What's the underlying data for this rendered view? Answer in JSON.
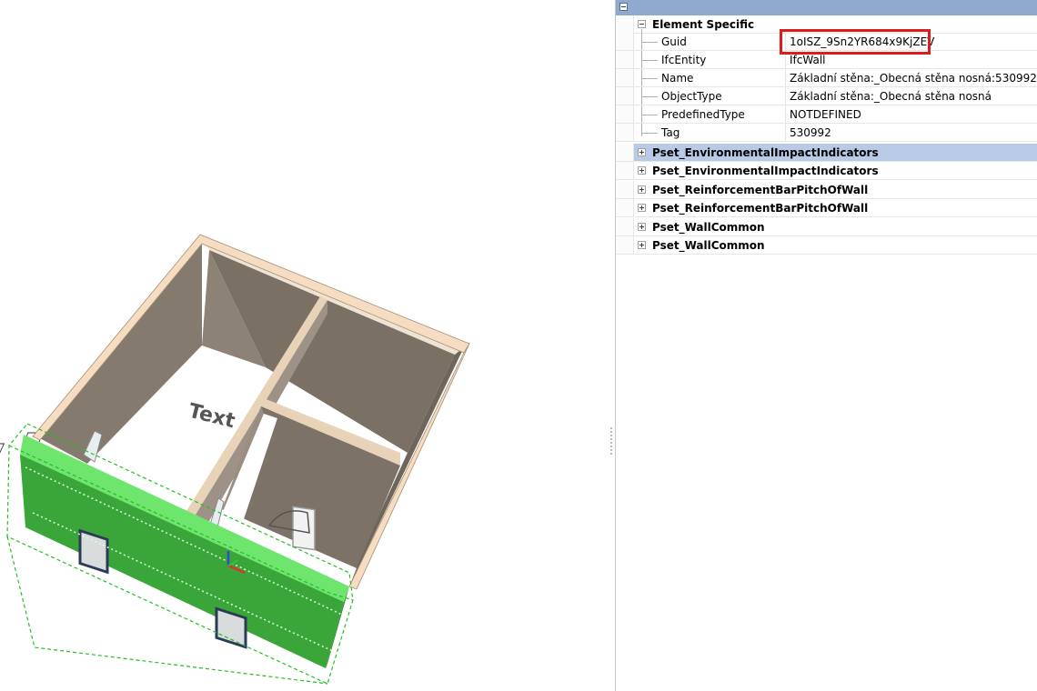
{
  "viewport": {
    "floor_text": "Text",
    "colors": {
      "wall_top": "#f6dcc0",
      "wall_inner": "#7b7064",
      "selected_wall": "#3aa63a",
      "selected_wall_top": "#6ee66e",
      "floor": "#ffffff"
    }
  },
  "properties": {
    "element_specific": {
      "label": "Element Specific",
      "rows": [
        {
          "name": "Guid",
          "value": "1oISZ_9Sn2YR684x9KjZEV"
        },
        {
          "name": "IfcEntity",
          "value": "IfcWall"
        },
        {
          "name": "Name",
          "value": "Základní stěna:_Obecná stěna nosná:530992"
        },
        {
          "name": "ObjectType",
          "value": "Základní stěna:_Obecná stěna nosná"
        },
        {
          "name": "PredefinedType",
          "value": "NOTDEFINED"
        },
        {
          "name": "Tag",
          "value": "530992"
        }
      ]
    },
    "psets": [
      {
        "label": "Pset_EnvironmentalImpactIndicators"
      },
      {
        "label": "Pset_EnvironmentalImpactIndicators"
      },
      {
        "label": "Pset_ReinforcementBarPitchOfWall"
      },
      {
        "label": "Pset_ReinforcementBarPitchOfWall"
      },
      {
        "label": "Pset_WallCommon"
      },
      {
        "label": "Pset_WallCommon"
      }
    ],
    "colors": {
      "header": "#8fa9cf",
      "selected_row": "#b9cae6",
      "highlight_box": "#e01b1b"
    }
  }
}
